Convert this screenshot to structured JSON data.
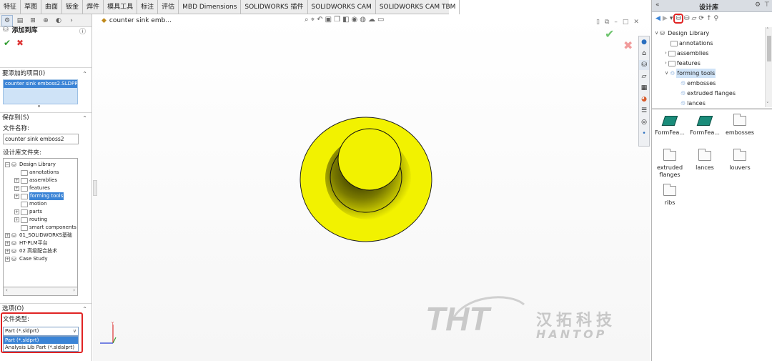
{
  "tabs": [
    "特征",
    "草图",
    "曲面",
    "钣金",
    "焊件",
    "模具工具",
    "标注",
    "评估",
    "MBD Dimensions",
    "SOLIDWORKS 插件",
    "SOLIDWORKS CAM",
    "SOLIDWORKS CAM TBM"
  ],
  "property_manager": {
    "title": "添加到库",
    "help_icon": "?",
    "items_section": "要添加的项目(I)",
    "items_selected": "counter sink emboss2.SLDPRT",
    "save_section": "保存到(S)",
    "file_name_label": "文件名称:",
    "file_name_value": "counter sink emboss2",
    "folder_label": "设计库文件夹:",
    "tree": [
      {
        "label": "Design Library",
        "icon": "library-icon"
      },
      {
        "label": "annotations",
        "icon": "folder-icon"
      },
      {
        "label": "assemblies",
        "icon": "folder-icon"
      },
      {
        "label": "features",
        "icon": "folder-icon"
      },
      {
        "label": "forming tools",
        "icon": "folder-icon",
        "selected": true
      },
      {
        "label": "motion",
        "icon": "folder-icon"
      },
      {
        "label": "parts",
        "icon": "folder-icon"
      },
      {
        "label": "routing",
        "icon": "folder-icon"
      },
      {
        "label": "smart components",
        "icon": "folder-icon"
      },
      {
        "label": "01_SOLIDWORKS基础",
        "icon": "library-icon"
      },
      {
        "label": "HT-PLM平台",
        "icon": "library-icon"
      },
      {
        "label": "02 高级配合技术",
        "icon": "library-icon"
      },
      {
        "label": "Case Study",
        "icon": "library-icon"
      }
    ],
    "options_section": "选项(O)",
    "file_type_label": "文件类型:",
    "file_type_value": "Part (*.sldprt)",
    "file_type_options": [
      "Part (*.sldprt)",
      "Analysis Lib Part (*.sldalprt)"
    ]
  },
  "graphics": {
    "document_title": "counter sink emb...",
    "part_color": "#f2f200",
    "watermark_logo": "THT",
    "watermark_cn": "汉拓科技",
    "watermark_en": "HANTOP"
  },
  "design_library": {
    "title": "设计库",
    "tree": [
      {
        "label": "Design Library"
      },
      {
        "label": "annotations"
      },
      {
        "label": "assemblies"
      },
      {
        "label": "features"
      },
      {
        "label": "forming tools",
        "selected": true
      },
      {
        "label": "embosses"
      },
      {
        "label": "extruded flanges"
      },
      {
        "label": "lances"
      }
    ],
    "tiles": [
      {
        "label": "FormFea...",
        "kind": "forming-tool"
      },
      {
        "label": "FormFea...",
        "kind": "forming-tool"
      },
      {
        "label": "embosses",
        "kind": "folder"
      },
      {
        "label": "extruded flanges",
        "kind": "folder"
      },
      {
        "label": "lances",
        "kind": "folder"
      },
      {
        "label": "louvers",
        "kind": "folder"
      },
      {
        "label": "ribs",
        "kind": "folder"
      }
    ]
  },
  "colors": {
    "highlight_red": "#e02424",
    "selection_blue": "#3b84d6",
    "accept_green": "#2e9b2e"
  }
}
